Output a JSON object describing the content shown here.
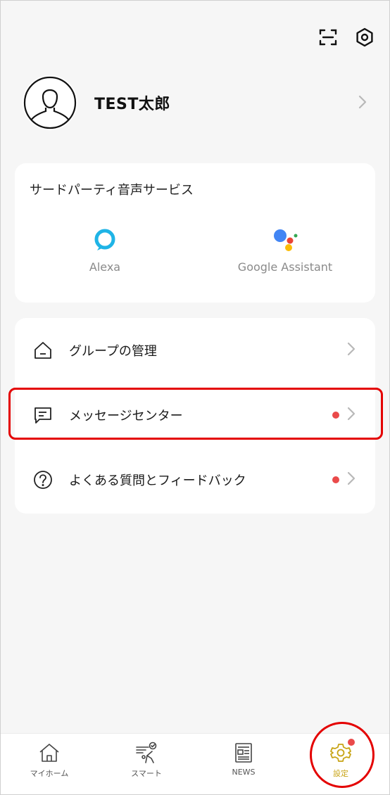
{
  "header": {
    "scan_icon": "scan-icon",
    "settings_icon": "hexagon-settings-icon"
  },
  "profile": {
    "name": "TEST太郎",
    "avatar_icon": "person-avatar-icon"
  },
  "voice_services": {
    "title": "サードパーティ音声サービス",
    "items": [
      {
        "label": "Alexa",
        "icon": "alexa-icon"
      },
      {
        "label": "Google Assistant",
        "icon": "google-assistant-icon"
      }
    ]
  },
  "menu": {
    "items": [
      {
        "label": "グループの管理",
        "icon": "home-icon",
        "badge": false
      },
      {
        "label": "メッセージセンター",
        "icon": "message-icon",
        "badge": true
      },
      {
        "label": "よくある質問とフィードバック",
        "icon": "help-icon",
        "badge": true
      }
    ]
  },
  "tabbar": {
    "tabs": [
      {
        "label": "マイホーム",
        "icon": "home-icon",
        "active": false
      },
      {
        "label": "スマート",
        "icon": "smart-icon",
        "active": false
      },
      {
        "label": "NEWS",
        "icon": "news-icon",
        "active": false
      },
      {
        "label": "設定",
        "icon": "gear-icon",
        "active": true,
        "badge": true
      }
    ]
  },
  "colors": {
    "accent": "#c8a416",
    "badge": "#ea4a4a",
    "highlight": "#e40000",
    "alexa": "#1fb4e6",
    "google_blue": "#4285f4",
    "google_red": "#ea4335",
    "google_yellow": "#fbbc05",
    "google_green": "#34a853"
  }
}
